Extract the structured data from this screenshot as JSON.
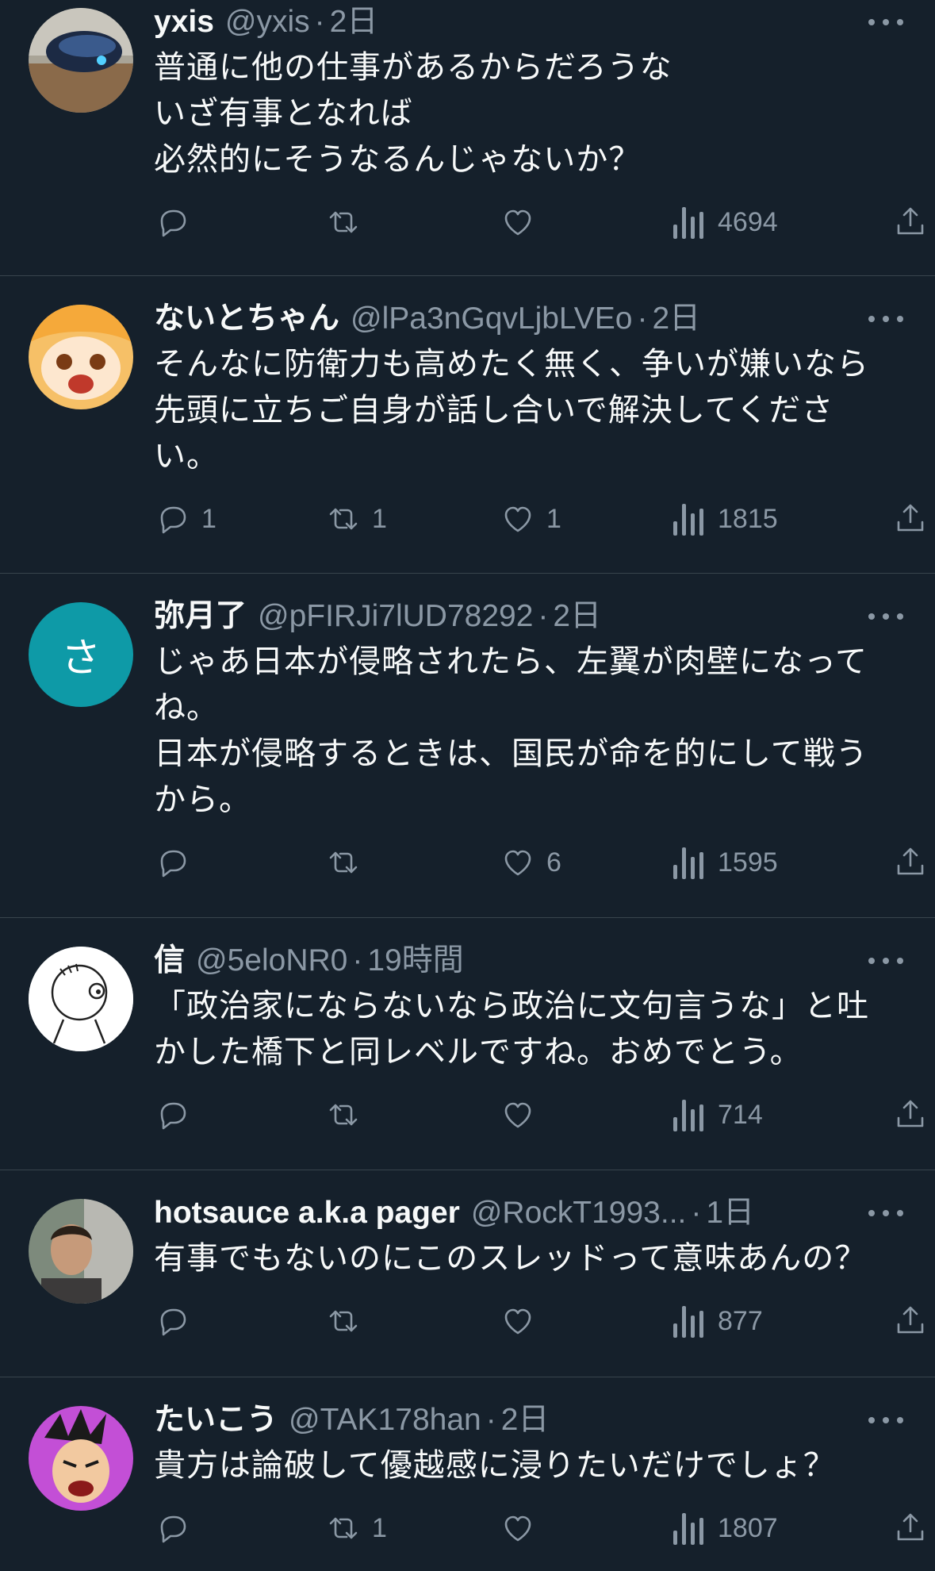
{
  "colors": {
    "background": "#15202b",
    "text": "#f7f9f9",
    "muted": "#8b98a5",
    "divider": "#38444d"
  },
  "tweets": [
    {
      "name": "yxis",
      "handle": "@yxis",
      "time": "2日",
      "text": "普通に他の仕事があるからだろうな\nいざ有事となれば\n必然的にそうなるんじゃないか？",
      "replies": "",
      "retweets": "",
      "likes": "",
      "views": "4694"
    },
    {
      "name": "ないとちゃん",
      "handle": "@lPa3nGqvLjbLVEo",
      "time": "2日",
      "text": "そんなに防衛力も高めたく無く、争いが嫌いなら\n先頭に立ちご自身が話し合いで解決してくださ\nい。",
      "replies": "1",
      "retweets": "1",
      "likes": "1",
      "views": "1815"
    },
    {
      "name": "弥月了",
      "handle": "@pFIRJi7lUD78292",
      "time": "2日",
      "avatar_letter": "さ",
      "text": "じゃあ日本が侵略されたら、左翼が肉壁になって\nね。\n日本が侵略するときは、国民が命を的にして戦う\nから。",
      "replies": "",
      "retweets": "",
      "likes": "6",
      "views": "1595"
    },
    {
      "name": "信",
      "handle": "@5eloNR0",
      "time": "19時間",
      "text": "「政治家にならないなら政治に文句言うな」と吐\nかした橋下と同レベルですね。おめでとう。",
      "replies": "",
      "retweets": "",
      "likes": "",
      "views": "714"
    },
    {
      "name": "hotsauce a.k.a pager",
      "handle": "@RockT1993...",
      "time": "1日",
      "text": "有事でもないのにこのスレッドって意味あんの？",
      "replies": "",
      "retweets": "",
      "likes": "",
      "views": "877"
    },
    {
      "name": "たいこう",
      "handle": "@TAK178han",
      "time": "2日",
      "text": "貴方は論破して優越感に浸りたいだけでしょ？",
      "replies": "",
      "retweets": "1",
      "likes": "",
      "views": "1807"
    }
  ]
}
